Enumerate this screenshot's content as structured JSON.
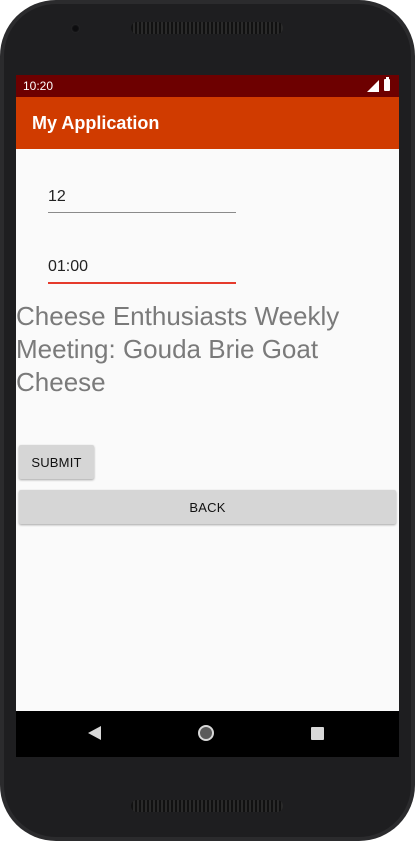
{
  "status_bar": {
    "time": "10:20",
    "icons": [
      "signal-icon",
      "battery-icon"
    ]
  },
  "app_bar": {
    "title": "My Application",
    "color": "#d03b00"
  },
  "form": {
    "hours_value": "12",
    "minutes_value": "01:00",
    "event_title": "Cheese Enthusiasts Weekly Meeting: Gouda Brie Goat Cheese",
    "submit_label": "SUBMIT",
    "back_label": "BACK"
  },
  "nav_bar": {
    "icons": [
      "nav-back-icon",
      "nav-home-icon",
      "nav-recents-icon"
    ]
  },
  "colors": {
    "status_bar": "#6d0000",
    "app_bar": "#d03b00",
    "focused_underline": "#e53a2c"
  }
}
